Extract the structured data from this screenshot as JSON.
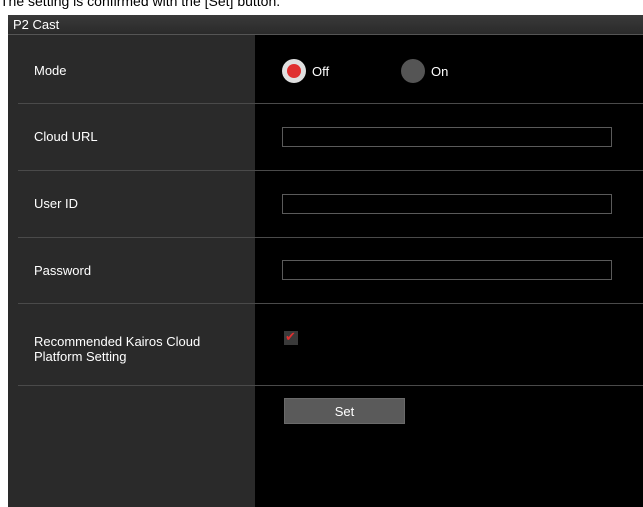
{
  "caption": "The setting is confirmed with the [Set] button.",
  "panel": {
    "title": "P2 Cast"
  },
  "rows": {
    "mode": {
      "label": "Mode",
      "options": [
        {
          "label": "Off",
          "selected": true
        },
        {
          "label": "On",
          "selected": false
        }
      ]
    },
    "cloud_url": {
      "label": "Cloud URL",
      "value": ""
    },
    "user_id": {
      "label": "User ID",
      "value": ""
    },
    "password": {
      "label": "Password",
      "value": ""
    },
    "recommended": {
      "label_line1": "Recommended Kairos Cloud",
      "label_line2": "Platform Setting",
      "checked": true
    }
  },
  "set_button": {
    "label": "Set"
  },
  "colors": {
    "accent_red": "#e03030",
    "panel_bg": "#000000",
    "label_col_bg": "#2a2a2a"
  }
}
